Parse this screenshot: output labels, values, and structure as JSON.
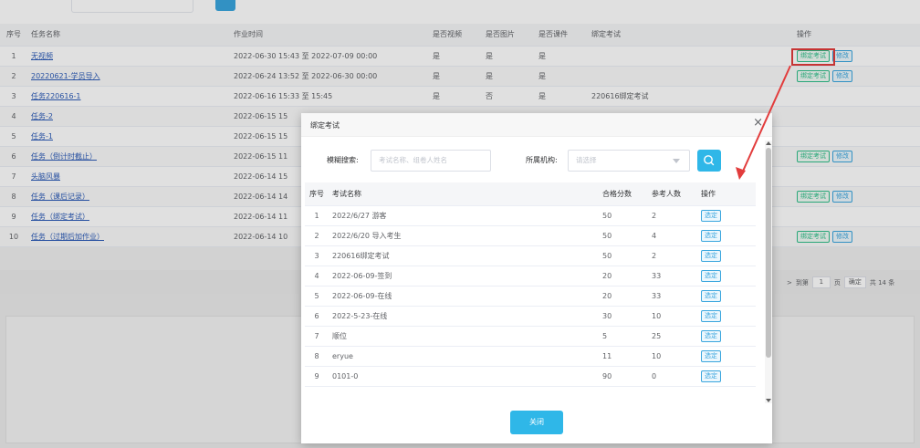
{
  "main": {
    "headers": [
      "序号",
      "任务名称",
      "作业时间",
      "是否视频",
      "是否图片",
      "是否课件",
      "绑定考试",
      "操作"
    ],
    "rows": [
      {
        "idx": "1",
        "name": "无视频",
        "time": "2022-06-30 15:43 至 2022-07-09 00:00",
        "video": "是",
        "image": "是",
        "courseware": "是",
        "exam": "",
        "ops": [
          "绑定考试",
          "修改"
        ]
      },
      {
        "idx": "2",
        "name": "20220621-学员导入",
        "time": "2022-06-24 13:52 至 2022-06-30 00:00",
        "video": "是",
        "image": "是",
        "courseware": "是",
        "exam": "",
        "ops": [
          "绑定考试",
          "修改"
        ]
      },
      {
        "idx": "3",
        "name": "任务220616-1",
        "time": "2022-06-16 15:33 至 15:45",
        "video": "是",
        "image": "否",
        "courseware": "是",
        "exam": "220616绑定考试",
        "ops": []
      },
      {
        "idx": "4",
        "name": "任务-2",
        "time": "2022-06-15 15",
        "video": "",
        "image": "",
        "courseware": "",
        "exam": "",
        "ops": []
      },
      {
        "idx": "5",
        "name": "任务-1",
        "time": "2022-06-15 15",
        "video": "",
        "image": "",
        "courseware": "",
        "exam": "",
        "ops": []
      },
      {
        "idx": "6",
        "name": "任务（倒计时截止）",
        "time": "2022-06-15 11",
        "video": "",
        "image": "",
        "courseware": "",
        "exam": "",
        "ops": [
          "绑定考试",
          "修改"
        ]
      },
      {
        "idx": "7",
        "name": "头脑风暴",
        "time": "2022-06-14 15",
        "video": "",
        "image": "",
        "courseware": "",
        "exam": "",
        "ops": []
      },
      {
        "idx": "8",
        "name": "任务（课后记录）",
        "time": "2022-06-14 14",
        "video": "",
        "image": "",
        "courseware": "",
        "exam": "",
        "ops": [
          "绑定考试",
          "修改"
        ]
      },
      {
        "idx": "9",
        "name": "任务（绑定考试）",
        "time": "2022-06-14 11",
        "video": "",
        "image": "",
        "courseware": "",
        "exam": "",
        "ops": []
      },
      {
        "idx": "10",
        "name": "任务（过期后加作业）",
        "time": "2022-06-14 10",
        "video": "",
        "image": "",
        "courseware": "",
        "exam": "",
        "ops": [
          "绑定考试",
          "修改"
        ]
      }
    ]
  },
  "pagination": {
    "next_arrow": ">",
    "goto_label": "到第",
    "page_value": "1",
    "page_unit": "页",
    "confirm": "确定",
    "total": "共 14 条"
  },
  "modal": {
    "title": "绑定考试",
    "close_icon": "×",
    "filter": {
      "search_label": "模糊搜索:",
      "search_placeholder": "考试名称、组卷人姓名",
      "org_label": "所属机构:",
      "org_placeholder": "请选择"
    },
    "table": {
      "headers": [
        "序号",
        "考试名称",
        "合格分数",
        "参考人数",
        "操作"
      ],
      "rows": [
        {
          "idx": "1",
          "name": "2022/6/27 游客",
          "pass": "50",
          "count": "2",
          "op": "选定"
        },
        {
          "idx": "2",
          "name": "2022/6/20 导入考生",
          "pass": "50",
          "count": "4",
          "op": "选定"
        },
        {
          "idx": "3",
          "name": "220616绑定考试",
          "pass": "50",
          "count": "2",
          "op": "选定"
        },
        {
          "idx": "4",
          "name": "2022-06-09-签到",
          "pass": "20",
          "count": "33",
          "op": "选定"
        },
        {
          "idx": "5",
          "name": "2022-06-09-在线",
          "pass": "20",
          "count": "33",
          "op": "选定"
        },
        {
          "idx": "6",
          "name": "2022-5-23-在线",
          "pass": "30",
          "count": "10",
          "op": "选定"
        },
        {
          "idx": "7",
          "name": "顺位",
          "pass": "5",
          "count": "25",
          "op": "选定"
        },
        {
          "idx": "8",
          "name": "eryue",
          "pass": "11",
          "count": "10",
          "op": "选定"
        },
        {
          "idx": "9",
          "name": "0101-0",
          "pass": "90",
          "count": "0",
          "op": "选定"
        }
      ]
    },
    "close_button": "关闭"
  },
  "colors": {
    "accent": "#2fb7e8",
    "bind_green": "#2fbf8a",
    "edit_blue": "#3aa6de",
    "link": "#2d5cb8",
    "highlight_red": "#e23c3c"
  }
}
